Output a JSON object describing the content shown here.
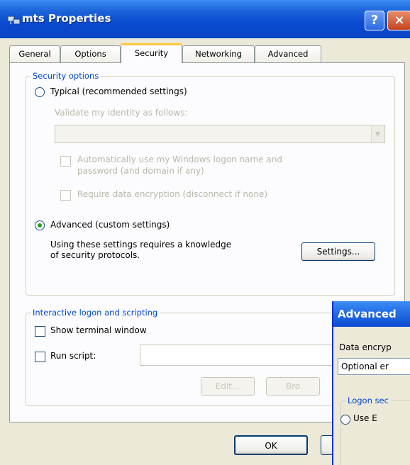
{
  "window": {
    "title": "mts Properties",
    "help_label": "?",
    "close_label": "×"
  },
  "tabs": [
    {
      "label": "General"
    },
    {
      "label": "Options"
    },
    {
      "label": "Security",
      "active": true
    },
    {
      "label": "Networking"
    },
    {
      "label": "Advanced"
    }
  ],
  "security_options": {
    "group_title": "Security options",
    "typical": {
      "label": "Typical (recommended settings)",
      "selected": false,
      "validate_label": "Validate my identity as follows:",
      "validate_value": "",
      "auto_logon_label_line1": "Automatically use my Windows logon name and",
      "auto_logon_label_line2": "password (and domain if any)",
      "require_encryption_label": "Require data encryption (disconnect if none)"
    },
    "advanced": {
      "label": "Advanced (custom settings)",
      "selected": true,
      "description_line1": "Using these settings requires a knowledge",
      "description_line2": "of security protocols.",
      "settings_button": "Settings..."
    }
  },
  "interactive_logon": {
    "group_title": "Interactive logon and scripting",
    "show_terminal_label": "Show terminal window",
    "run_script_label": "Run script:",
    "script_value": "",
    "edit_button": "Edit...",
    "browse_button": "Bro"
  },
  "footer": {
    "ok_button": "OK"
  },
  "advanced_dialog": {
    "title": "Advanced",
    "data_encryption_label": "Data encryp",
    "data_encryption_value": "Optional er",
    "logon_security_title": "Logon sec",
    "use_option_label": "Use E"
  },
  "colors": {
    "titlebar_blue": "#0a4ad0",
    "group_title_blue": "#0046d5",
    "dialog_bg": "#ece9d8",
    "tab_highlight": "#ffc83c"
  }
}
